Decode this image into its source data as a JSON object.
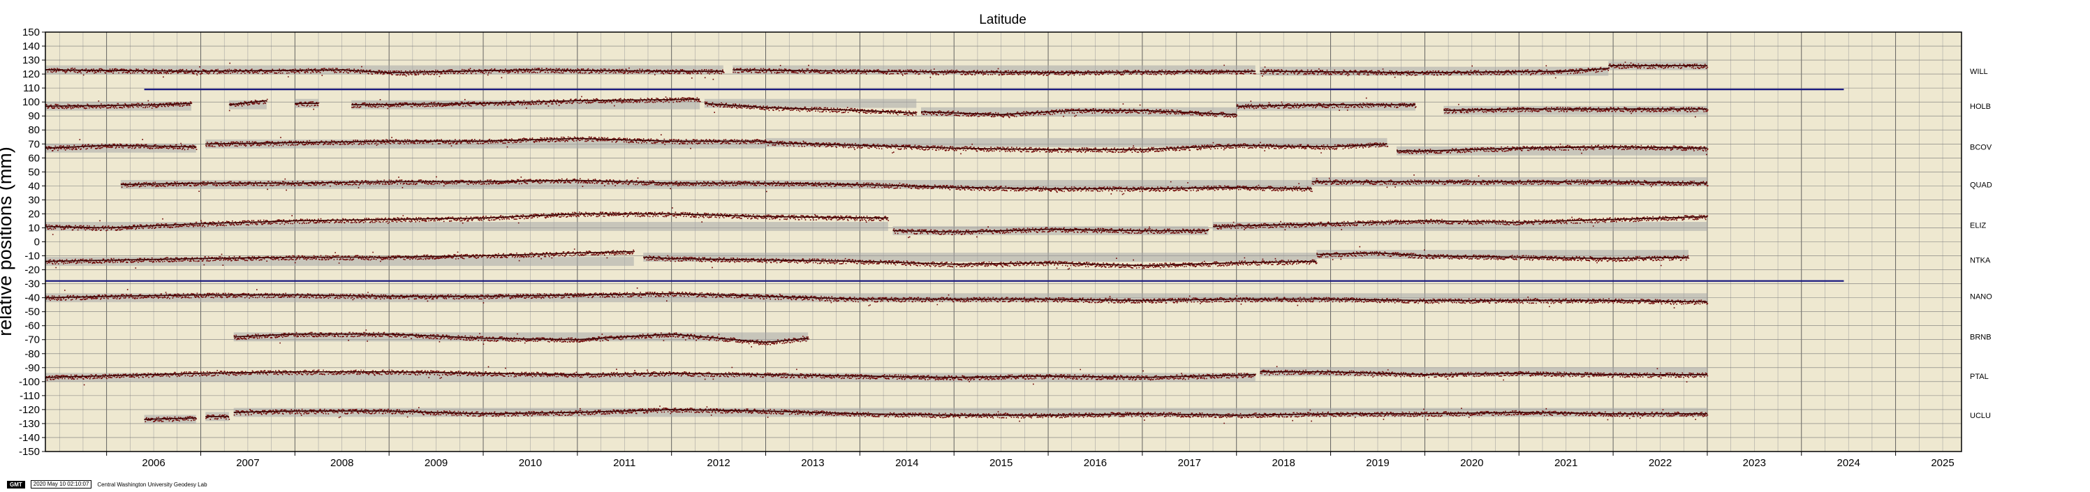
{
  "chart_data": {
    "type": "scatter",
    "title": "Latitude",
    "ylabel": "relative positions (mm)",
    "xlabel": "",
    "xlim": [
      2005.35,
      2025.7
    ],
    "ylim": [
      -150,
      150
    ],
    "y_ticks": [
      150,
      140,
      130,
      120,
      110,
      100,
      90,
      80,
      70,
      60,
      50,
      40,
      30,
      20,
      10,
      0,
      -10,
      -20,
      -30,
      -40,
      -50,
      -60,
      -70,
      -80,
      -90,
      -100,
      -110,
      -120,
      -130,
      -140,
      -150
    ],
    "x_ticks": [
      "2006",
      "2007",
      "2008",
      "2009",
      "2010",
      "2011",
      "2012",
      "2013",
      "2014",
      "2015",
      "2016",
      "2017",
      "2018",
      "2019",
      "2020",
      "2021",
      "2022",
      "2023",
      "2024",
      "2025"
    ],
    "grid": true,
    "background_color": "#eee8d0",
    "point_color": "#6b0000",
    "envelope_color": "#a8a8a8",
    "hline_color": "#1a1a80",
    "horizontal_lines": [
      {
        "y": 109,
        "x_start": 2006.4,
        "x_end": 2024.45
      },
      {
        "y": -28,
        "x_start": 2005.35,
        "x_end": 2024.45
      }
    ],
    "series": [
      {
        "name": "WILL",
        "offset": 122,
        "segments": [
          {
            "x": [
              2005.35,
              2007.0,
              2008.5,
              2009.0,
              2010.5,
              2012.0,
              2012.55
            ],
            "y": [
              123,
              122,
              123,
              121,
              123,
              122,
              122
            ]
          },
          {
            "x": [
              2012.65,
              2014.0,
              2016.0,
              2018.2
            ],
            "y": [
              123,
              122,
              121,
              122
            ]
          },
          {
            "x": [
              2018.25,
              2020.0,
              2021.5,
              2021.95
            ],
            "y": [
              122,
              121,
              122,
              124
            ]
          },
          {
            "x": [
              2021.95,
              2022.4,
              2023.0
            ],
            "y": [
              126,
              126,
              126
            ]
          }
        ]
      },
      {
        "name": "HOLB",
        "offset": 97,
        "segments": [
          {
            "x": [
              2005.35,
              2006.5,
              2006.9
            ],
            "y": [
              97,
              98,
              99
            ]
          },
          {
            "x": [
              2007.3,
              2007.7
            ],
            "y": [
              98,
              101
            ]
          },
          {
            "x": [
              2008.0,
              2008.25
            ],
            "y": [
              99,
              99
            ]
          },
          {
            "x": [
              2008.6,
              2010.0,
              2011.0,
              2012.3
            ],
            "y": [
              98,
              99,
              101,
              102
            ]
          },
          {
            "x": [
              2012.35,
              2013.0,
              2014.0,
              2014.6
            ],
            "y": [
              99,
              96,
              94,
              92
            ]
          },
          {
            "x": [
              2014.65,
              2015.5,
              2016.3,
              2017.0,
              2018.0
            ],
            "y": [
              93,
              91,
              94,
              94,
              91
            ]
          },
          {
            "x": [
              2018.0,
              2019.0,
              2019.9
            ],
            "y": [
              97,
              98,
              98
            ]
          },
          {
            "x": [
              2020.2,
              2021.0,
              2022.0,
              2023.0
            ],
            "y": [
              94,
              95,
              95,
              95
            ]
          }
        ]
      },
      {
        "name": "BCOV",
        "offset": 68,
        "segments": [
          {
            "x": [
              2005.35,
              2006.0,
              2006.95
            ],
            "y": [
              67,
              69,
              68
            ]
          },
          {
            "x": [
              2007.05,
              2008.0,
              2009.0,
              2010.0,
              2011.0,
              2012.0,
              2013.0
            ],
            "y": [
              70,
              71,
              72,
              72,
              74,
              72,
              72
            ]
          },
          {
            "x": [
              2013.0,
              2014.0,
              2015.0,
              2016.0,
              2017.0,
              2018.0,
              2019.0,
              2019.6
            ],
            "y": [
              71,
              69,
              67,
              66,
              66,
              69,
              68,
              70
            ]
          },
          {
            "x": [
              2019.7,
              2020.0,
              2021.0,
              2022.0,
              2023.0
            ],
            "y": [
              65,
              65,
              67,
              68,
              67
            ]
          }
        ]
      },
      {
        "name": "QUAD",
        "offset": 41,
        "segments": [
          {
            "x": [
              2006.15,
              2007.0,
              2008.0,
              2009.0,
              2010.0,
              2011.0,
              2012.0,
              2013.0,
              2014.0,
              2015.0,
              2016.0,
              2017.0,
              2018.0,
              2018.8
            ],
            "y": [
              41,
              42,
              42,
              43,
              43,
              44,
              42,
              42,
              41,
              39,
              38,
              38,
              39,
              38
            ]
          },
          {
            "x": [
              2018.8,
              2020.0,
              2021.0,
              2022.0,
              2023.0
            ],
            "y": [
              43,
              43,
              43,
              43,
              42
            ]
          }
        ]
      },
      {
        "name": "ELIZ",
        "offset": 12,
        "segments": [
          {
            "x": [
              2005.35,
              2006.0,
              2007.0,
              2008.0,
              2009.0,
              2010.0,
              2011.0,
              2012.0,
              2013.0,
              2014.3
            ],
            "y": [
              11,
              10,
              13,
              15,
              16,
              17,
              20,
              20,
              18,
              17
            ]
          },
          {
            "x": [
              2014.35,
              2015.0,
              2016.0,
              2017.0,
              2017.7
            ],
            "y": [
              8,
              7,
              9,
              8,
              8
            ]
          },
          {
            "x": [
              2017.75,
              2019.0,
              2020.0,
              2021.0,
              2022.0,
              2023.0
            ],
            "y": [
              11,
              13,
              15,
              14,
              16,
              18
            ]
          }
        ]
      },
      {
        "name": "NTKA",
        "offset": -13,
        "segments": [
          {
            "x": [
              2005.35,
              2007.0,
              2008.0,
              2009.0,
              2010.0,
              2011.0,
              2011.6
            ],
            "y": [
              -14,
              -12,
              -11,
              -11,
              -10,
              -8,
              -7
            ]
          },
          {
            "x": [
              2011.7,
              2012.0,
              2013.0,
              2014.0,
              2015.0,
              2016.0,
              2017.0,
              2018.0,
              2018.85
            ],
            "y": [
              -11,
              -12,
              -13,
              -14,
              -16,
              -15,
              -17,
              -15,
              -14
            ]
          },
          {
            "x": [
              2018.85,
              2019.5,
              2020.0,
              2021.0,
              2022.0,
              2022.8
            ],
            "y": [
              -9,
              -8,
              -10,
              -11,
              -12,
              -11
            ]
          }
        ]
      },
      {
        "name": "NANO",
        "offset": -39,
        "segments": [
          {
            "x": [
              2005.35,
              2006.0,
              2007.0,
              2008.0,
              2009.0,
              2010.0,
              2011.0,
              2012.0,
              2013.0,
              2014.0,
              2015.0,
              2016.0,
              2017.0,
              2018.0,
              2019.0,
              2020.0,
              2021.0,
              2022.0,
              2023.0
            ],
            "y": [
              -40,
              -39,
              -38,
              -38,
              -39,
              -39,
              -38,
              -37,
              -39,
              -41,
              -41,
              -41,
              -42,
              -41,
              -41,
              -42,
              -42,
              -42,
              -43
            ]
          }
        ]
      },
      {
        "name": "BRNB",
        "offset": -68,
        "segments": [
          {
            "x": [
              2007.35,
              2008.0,
              2009.0,
              2010.0,
              2011.0,
              2012.0,
              2013.0,
              2013.45
            ],
            "y": [
              -68,
              -66,
              -66,
              -69,
              -70,
              -66,
              -72,
              -69
            ]
          }
        ]
      },
      {
        "name": "PTAL",
        "offset": -96,
        "segments": [
          {
            "x": [
              2005.35,
              2007.0,
              2008.0,
              2009.0,
              2010.0,
              2011.0,
              2012.0,
              2013.0,
              2014.0,
              2015.0,
              2016.0,
              2017.0,
              2018.2
            ],
            "y": [
              -97,
              -94,
              -93,
              -93,
              -94,
              -95,
              -94,
              -95,
              -96,
              -97,
              -96,
              -97,
              -95
            ]
          },
          {
            "x": [
              2018.25,
              2019.0,
              2020.0,
              2021.0,
              2022.0,
              2023.0
            ],
            "y": [
              -93,
              -93,
              -95,
              -94,
              -95,
              -95
            ]
          }
        ]
      },
      {
        "name": "UCLU",
        "offset": -124,
        "segments": [
          {
            "x": [
              2006.4,
              2006.95
            ],
            "y": [
              -127,
              -126
            ]
          },
          {
            "x": [
              2007.05,
              2007.3
            ],
            "y": [
              -125,
              -125
            ]
          },
          {
            "x": [
              2007.35,
              2008.0,
              2009.0,
              2010.0,
              2011.0,
              2012.0,
              2013.0,
              2014.0,
              2015.0,
              2016.0,
              2017.0,
              2018.0,
              2019.0,
              2020.0,
              2021.0,
              2022.0,
              2023.0
            ],
            "y": [
              -122,
              -121,
              -121,
              -123,
              -122,
              -120,
              -121,
              -123,
              -124,
              -124,
              -123,
              -124,
              -123,
              -123,
              -122,
              -123,
              -123
            ]
          }
        ]
      }
    ]
  },
  "footer": {
    "badge": "GMT",
    "timestamp": "2020 May 10 02:10:07",
    "credit": "Central Washington University Geodesy Lab"
  }
}
